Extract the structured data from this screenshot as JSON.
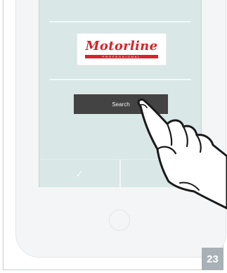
{
  "screen": {
    "logo": {
      "name": "Motorline",
      "tagline": "PROFESSIONAL"
    },
    "search_button_label": "Search",
    "bottom_bar": {
      "left_icon": "checkmark-icon",
      "left_glyph": "✓",
      "right_icon": "unknown-icon"
    }
  },
  "device": {
    "home_button": "home-button"
  },
  "page_number": "23",
  "colors": {
    "screen_background": "#d9e7e6",
    "button": "#434343",
    "brand_red": "#d8232a",
    "page_badge": "#a9b0b6"
  }
}
